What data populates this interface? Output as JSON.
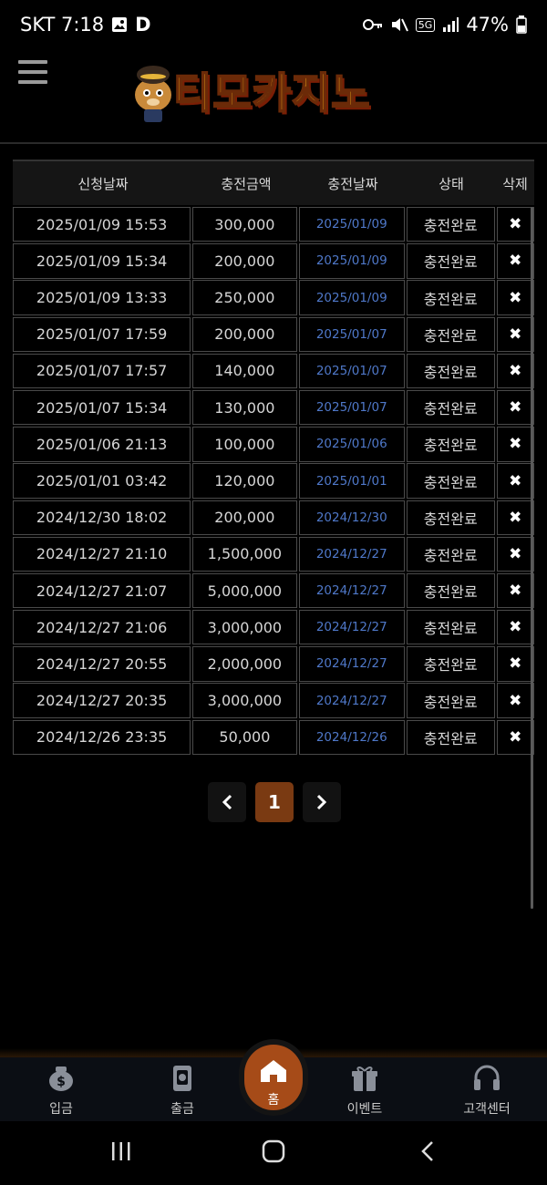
{
  "status_bar": {
    "carrier_time": "SKT 7:18",
    "letter": "D",
    "network": "5G",
    "battery": "47%"
  },
  "header": {
    "logo_text": "티모카지노"
  },
  "table": {
    "columns": [
      "신청날짜",
      "충전금액",
      "충전날짜",
      "상태",
      "삭제"
    ],
    "rows": [
      {
        "request_date": "2025/01/09 15:53",
        "amount": "300,000",
        "charge_date": "2025/01/09",
        "status": "충전완료"
      },
      {
        "request_date": "2025/01/09 15:34",
        "amount": "200,000",
        "charge_date": "2025/01/09",
        "status": "충전완료"
      },
      {
        "request_date": "2025/01/09 13:33",
        "amount": "250,000",
        "charge_date": "2025/01/09",
        "status": "충전완료"
      },
      {
        "request_date": "2025/01/07 17:59",
        "amount": "200,000",
        "charge_date": "2025/01/07",
        "status": "충전완료"
      },
      {
        "request_date": "2025/01/07 17:57",
        "amount": "140,000",
        "charge_date": "2025/01/07",
        "status": "충전완료"
      },
      {
        "request_date": "2025/01/07 15:34",
        "amount": "130,000",
        "charge_date": "2025/01/07",
        "status": "충전완료"
      },
      {
        "request_date": "2025/01/06 21:13",
        "amount": "100,000",
        "charge_date": "2025/01/06",
        "status": "충전완료"
      },
      {
        "request_date": "2025/01/01 03:42",
        "amount": "120,000",
        "charge_date": "2025/01/01",
        "status": "충전완료"
      },
      {
        "request_date": "2024/12/30 18:02",
        "amount": "200,000",
        "charge_date": "2024/12/30",
        "status": "충전완료"
      },
      {
        "request_date": "2024/12/27 21:10",
        "amount": "1,500,000",
        "charge_date": "2024/12/27",
        "status": "충전완료"
      },
      {
        "request_date": "2024/12/27 21:07",
        "amount": "5,000,000",
        "charge_date": "2024/12/27",
        "status": "충전완료"
      },
      {
        "request_date": "2024/12/27 21:06",
        "amount": "3,000,000",
        "charge_date": "2024/12/27",
        "status": "충전완료"
      },
      {
        "request_date": "2024/12/27 20:55",
        "amount": "2,000,000",
        "charge_date": "2024/12/27",
        "status": "충전완료"
      },
      {
        "request_date": "2024/12/27 20:35",
        "amount": "3,000,000",
        "charge_date": "2024/12/27",
        "status": "충전완료"
      },
      {
        "request_date": "2024/12/26 23:35",
        "amount": "50,000",
        "charge_date": "2024/12/26",
        "status": "충전완료"
      }
    ],
    "delete_glyph": "✖"
  },
  "pagination": {
    "prev_glyph": "‹",
    "current_page": "1",
    "next_glyph": "›"
  },
  "bottom_nav": {
    "items": [
      {
        "label": "입금",
        "icon": "money-bag-icon"
      },
      {
        "label": "출금",
        "icon": "wallet-icon"
      },
      {
        "label": "홈",
        "icon": "home-icon"
      },
      {
        "label": "이벤트",
        "icon": "gift-icon"
      },
      {
        "label": "고객센터",
        "icon": "headset-icon"
      }
    ]
  },
  "colors": {
    "accent": "#a64b18",
    "link_date": "#4f78c9",
    "background": "#000000"
  }
}
